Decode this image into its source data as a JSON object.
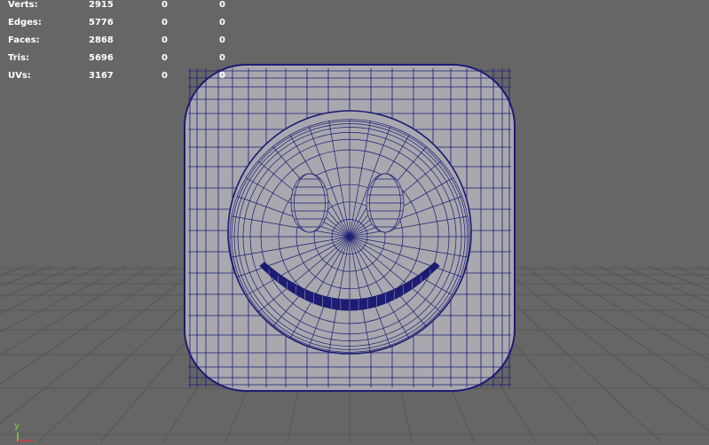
{
  "heads_up_display": {
    "rows": [
      {
        "label": "Verts:",
        "v1": "2915",
        "v2": "0",
        "v3": "0"
      },
      {
        "label": "Edges:",
        "v1": "5776",
        "v2": "0",
        "v3": "0"
      },
      {
        "label": "Faces:",
        "v1": "2868",
        "v2": "0",
        "v3": "0"
      },
      {
        "label": "Tris:",
        "v1": "5696",
        "v2": "0",
        "v3": "0"
      },
      {
        "label": "UVs:",
        "v1": "3167",
        "v2": "0",
        "v3": "0"
      }
    ]
  },
  "axis_gizmo": {
    "y_label": "y",
    "y_color": "#7fd43a",
    "x_color": "#d43a3a"
  },
  "colors": {
    "background": "#666666",
    "grid": "#555555",
    "mesh_fill": "#a8a8ae",
    "wireframe": "#1c1c74",
    "hud_text": "#ffffff"
  },
  "icons": {
    "model": "smiley-cube-mesh",
    "gizmo": "axis-gizmo-icon"
  }
}
